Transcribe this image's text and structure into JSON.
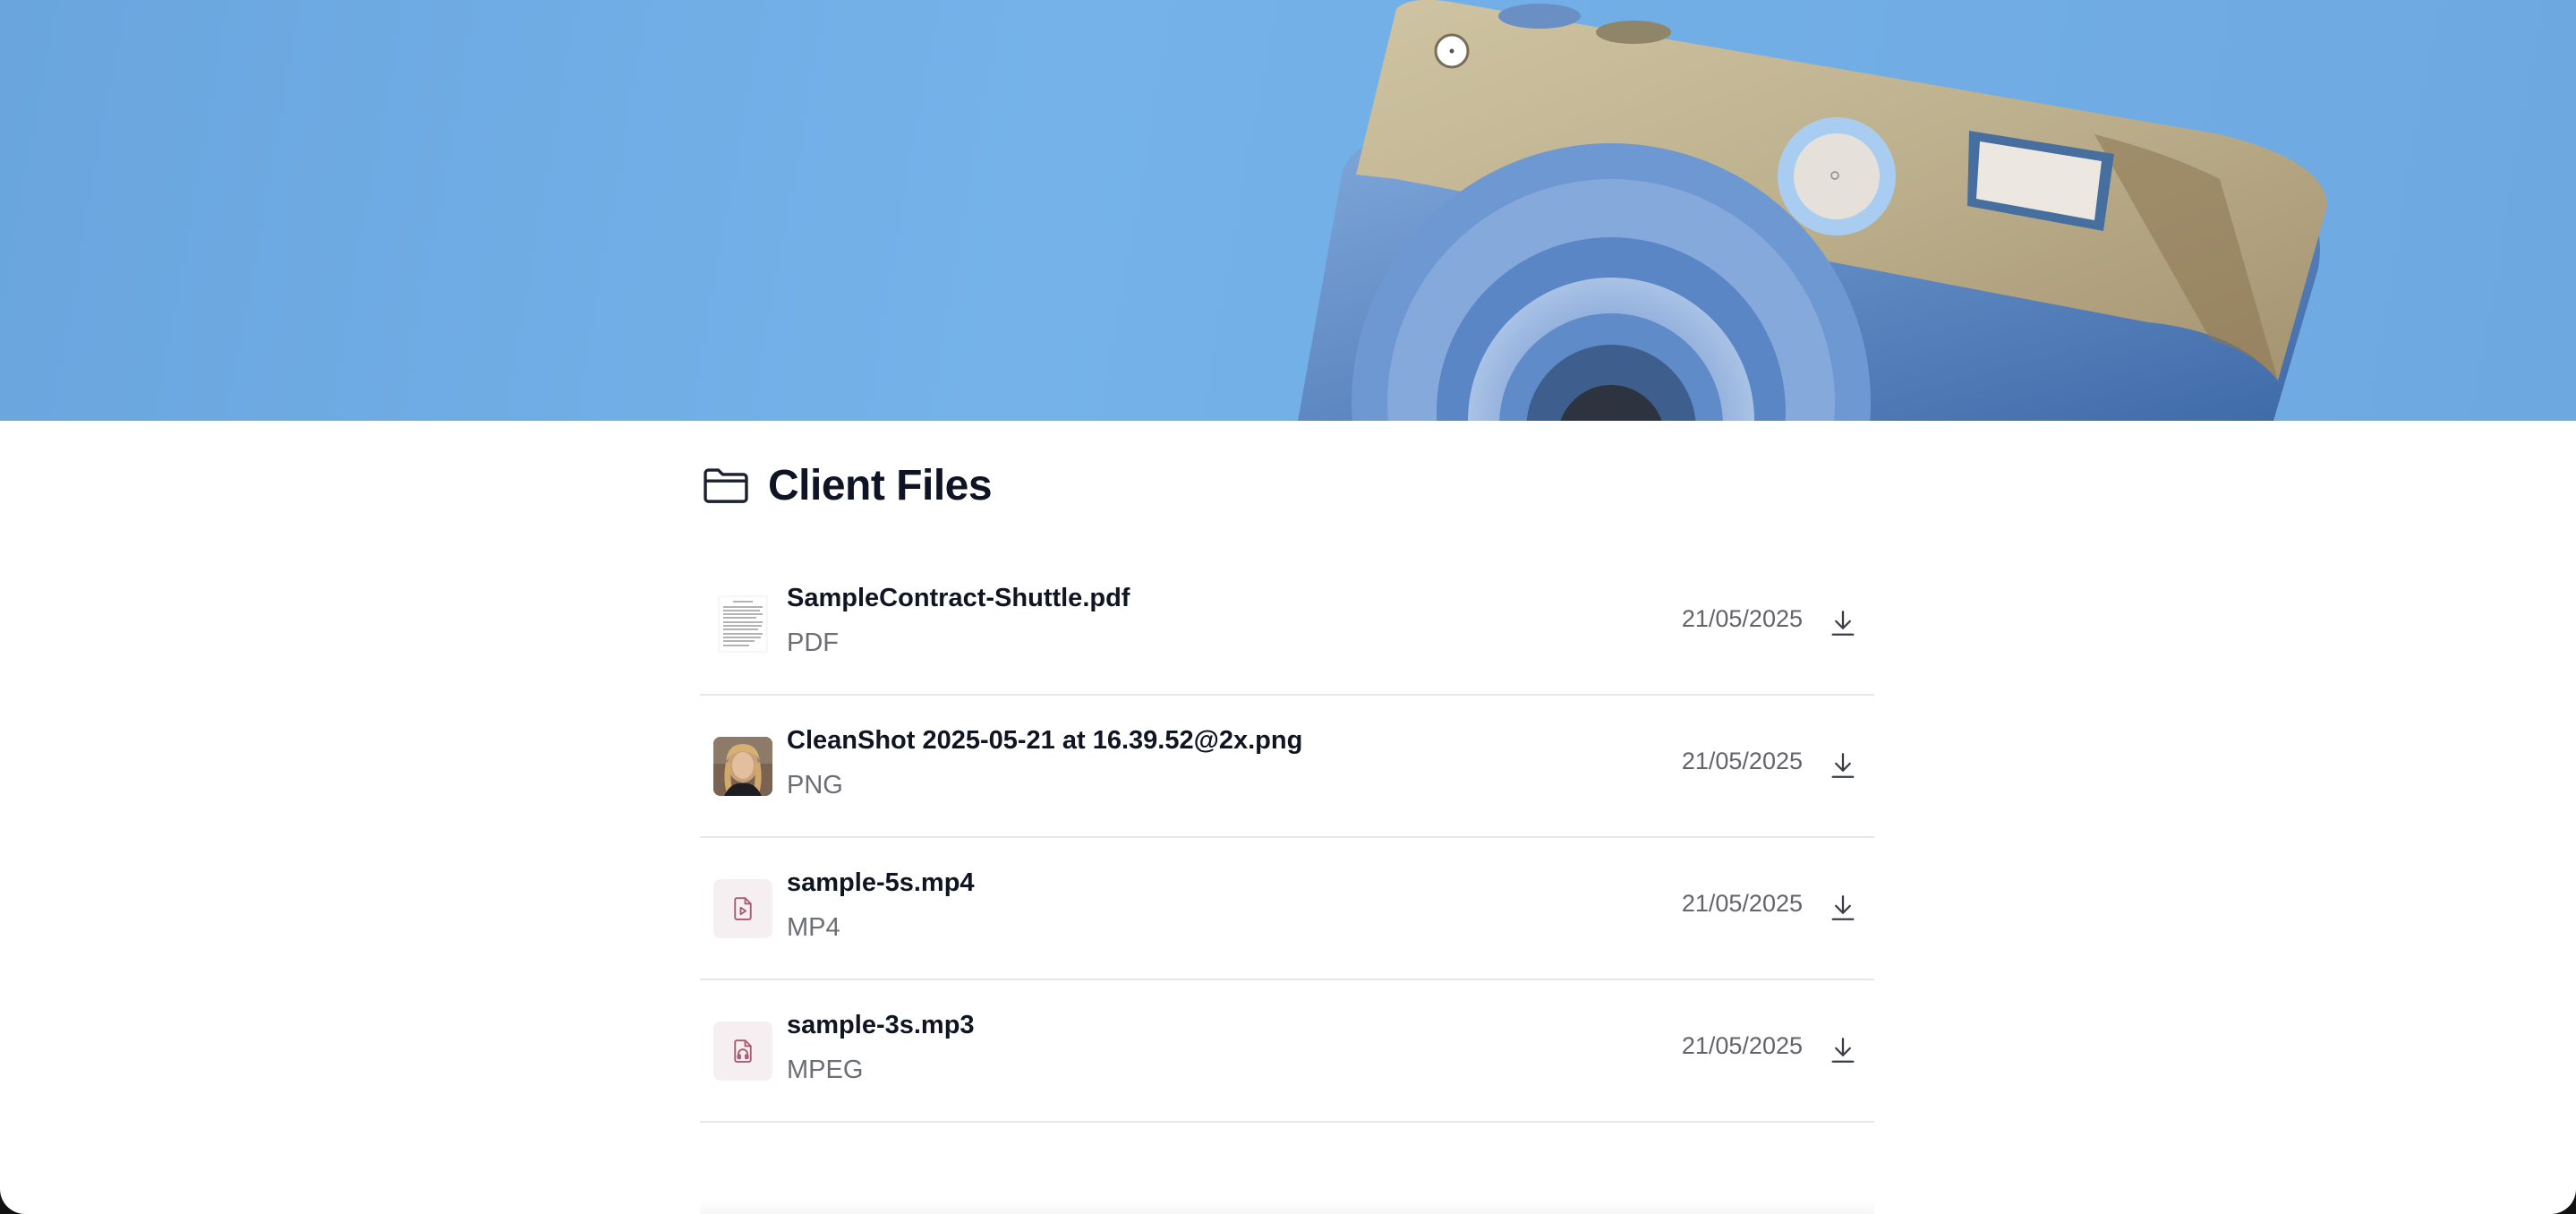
{
  "section": {
    "title": "Client Files",
    "icon": "folder-icon"
  },
  "files": [
    {
      "name": "SampleContract-Shuttle.pdf",
      "type": "PDF",
      "date": "21/05/2025",
      "thumbnail": "document-thumbnail"
    },
    {
      "name": "CleanShot 2025-05-21 at 16.39.52@2x.png",
      "type": "PNG",
      "date": "21/05/2025",
      "thumbnail": "photo-thumbnail"
    },
    {
      "name": "sample-5s.mp4",
      "type": "MP4",
      "date": "21/05/2025",
      "thumbnail": "video-file-icon"
    },
    {
      "name": "sample-3s.mp3",
      "type": "MPEG",
      "date": "21/05/2025",
      "thumbnail": "audio-file-icon"
    }
  ],
  "colors": {
    "hero_sky": "#72aee6",
    "camera_wood": "#c7bb9a",
    "camera_blue": "#5b8cc8",
    "media_icon_tint": "#a85b72"
  }
}
